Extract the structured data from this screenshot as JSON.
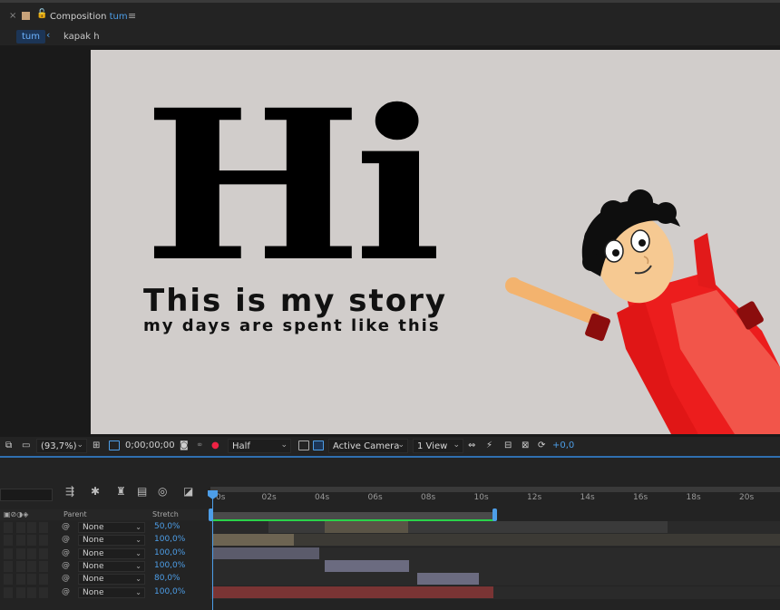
{
  "tab": {
    "close": "×",
    "lock": "🔓",
    "title_prefix": "Composition",
    "title_name": "tum",
    "menu": "≡"
  },
  "breadcrumbs": {
    "active": "tum",
    "other": "kapak h"
  },
  "canvas": {
    "hi": "Hi",
    "story": "This is my story",
    "days": "my days are spent like this",
    "bg": "#d1cdcb"
  },
  "viewer_toolbar": {
    "zoom": "(93,7%)",
    "timecode": "0;00;00;00",
    "resolution": "Half",
    "camera": "Active Camera",
    "views": "1 View",
    "exposure": "+0,0"
  },
  "timeline": {
    "ticks": [
      "0s",
      "02s",
      "04s",
      "06s",
      "08s",
      "10s",
      "12s",
      "14s",
      "16s",
      "18s",
      "20s"
    ],
    "col_parent": "Parent",
    "col_stretch": "Stretch",
    "layers": [
      {
        "parent": "None",
        "stretch": "50,0%"
      },
      {
        "parent": "None",
        "stretch": "100,0%"
      },
      {
        "parent": "None",
        "stretch": "100,0%"
      },
      {
        "parent": "None",
        "stretch": "100,0%"
      },
      {
        "parent": "None",
        "stretch": "80,0%"
      },
      {
        "parent": "None",
        "stretch": "100,0%"
      }
    ]
  }
}
